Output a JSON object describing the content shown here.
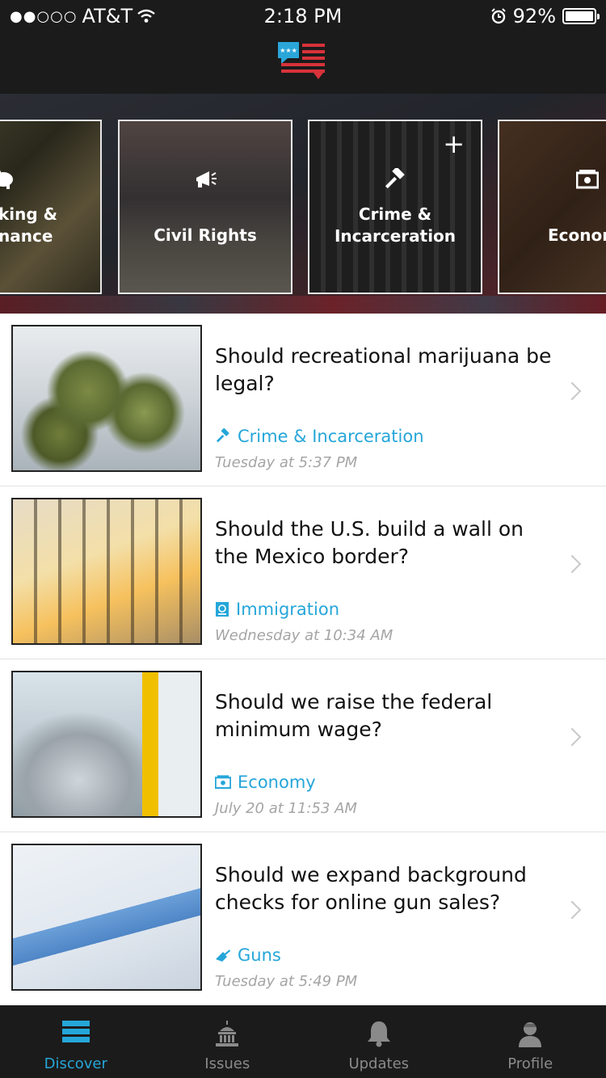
{
  "status_bar": {
    "signal": "●●○○○",
    "carrier": "AT&T",
    "time": "2:18 PM",
    "battery_percent": "92%",
    "icons": [
      "signal-dots-icon",
      "wifi-icon",
      "alarm-icon",
      "battery-icon"
    ]
  },
  "header": {
    "logo": "flag-speech-bubble-logo"
  },
  "categories": [
    {
      "label": "king &\nnance",
      "icon": "piggy-bank-icon"
    },
    {
      "label": "Civil Rights",
      "icon": "megaphone-icon"
    },
    {
      "label": "Crime &\nIncarceration",
      "icon": "gavel-icon",
      "follow": "+"
    },
    {
      "label": "Econom",
      "icon": "money-icon"
    }
  ],
  "feed": [
    {
      "question": "Should recreational marijuana be legal?",
      "topic": "Crime & Incarceration",
      "topic_icon": "gavel-icon",
      "time": "Tuesday at 5:37 PM"
    },
    {
      "question": "Should the U.S. build a wall on the Mexico border?",
      "topic": "Immigration",
      "topic_icon": "passport-icon",
      "time": "Wednesday at 10:34 AM"
    },
    {
      "question": "Should we raise the federal minimum wage?",
      "topic": "Economy",
      "topic_icon": "money-icon",
      "time": "July 20 at 11:53 AM"
    },
    {
      "question": "Should we expand background checks for online gun sales?",
      "topic": "Guns",
      "topic_icon": "gun-icon",
      "time": "Tuesday at 5:49 PM"
    }
  ],
  "tabbar": {
    "tabs": [
      {
        "label": "Discover",
        "icon": "discover-icon",
        "active": true
      },
      {
        "label": "Issues",
        "icon": "capitol-icon",
        "active": false
      },
      {
        "label": "Updates",
        "icon": "bell-icon",
        "active": false
      },
      {
        "label": "Profile",
        "icon": "profile-icon",
        "active": false
      }
    ]
  },
  "colors": {
    "accent": "#25a6d9",
    "bar_background": "#1b1b1b",
    "logo_red": "#d8323a",
    "logo_blue": "#2aa6d9"
  }
}
